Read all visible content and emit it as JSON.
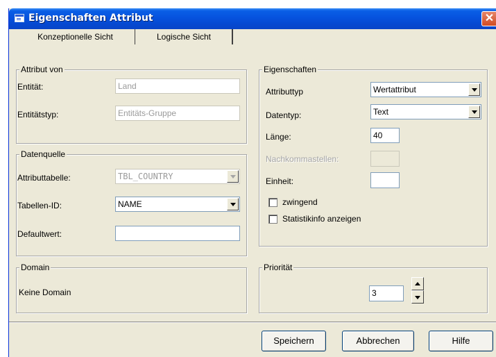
{
  "window": {
    "title": "Eigenschaften Attribut",
    "close_label": "✕"
  },
  "tabs": [
    {
      "label": "Konzeptionelle Sicht"
    },
    {
      "label": "Logische Sicht"
    }
  ],
  "attribut_von": {
    "title": "Attribut von",
    "entitaet_label": "Entität:",
    "entitaet_value": "Land",
    "entitaetstyp_label": "Entitätstyp:",
    "entitaetstyp_value": "Entitäts-Gruppe"
  },
  "datenquelle": {
    "title": "Datenquelle",
    "attributtabelle_label": "Attributtabelle:",
    "attributtabelle_value": "TBL_COUNTRY",
    "tabellen_id_label": "Tabellen-ID:",
    "tabellen_id_value": "NAME",
    "defaultwert_label": "Defaultwert:",
    "defaultwert_value": ""
  },
  "domain": {
    "title": "Domain",
    "value": "Keine Domain"
  },
  "eigenschaften": {
    "title": "Eigenschaften",
    "attributtyp_label": "Attributtyp",
    "attributtyp_value": "Wertattribut",
    "datentyp_label": "Datentyp:",
    "datentyp_value": "Text",
    "laenge_label": "Länge:",
    "laenge_value": "40",
    "nachkommastellen_label": "Nachkommastellen:",
    "nachkommastellen_value": "",
    "einheit_label": "Einheit:",
    "einheit_value": "",
    "zwingend_label": "zwingend",
    "statistik_label": "Statistikinfo anzeigen"
  },
  "prioritaet": {
    "title": "Priorität",
    "value": "3"
  },
  "buttons": {
    "save": "Speichern",
    "cancel": "Abbrechen",
    "help": "Hilfe"
  }
}
